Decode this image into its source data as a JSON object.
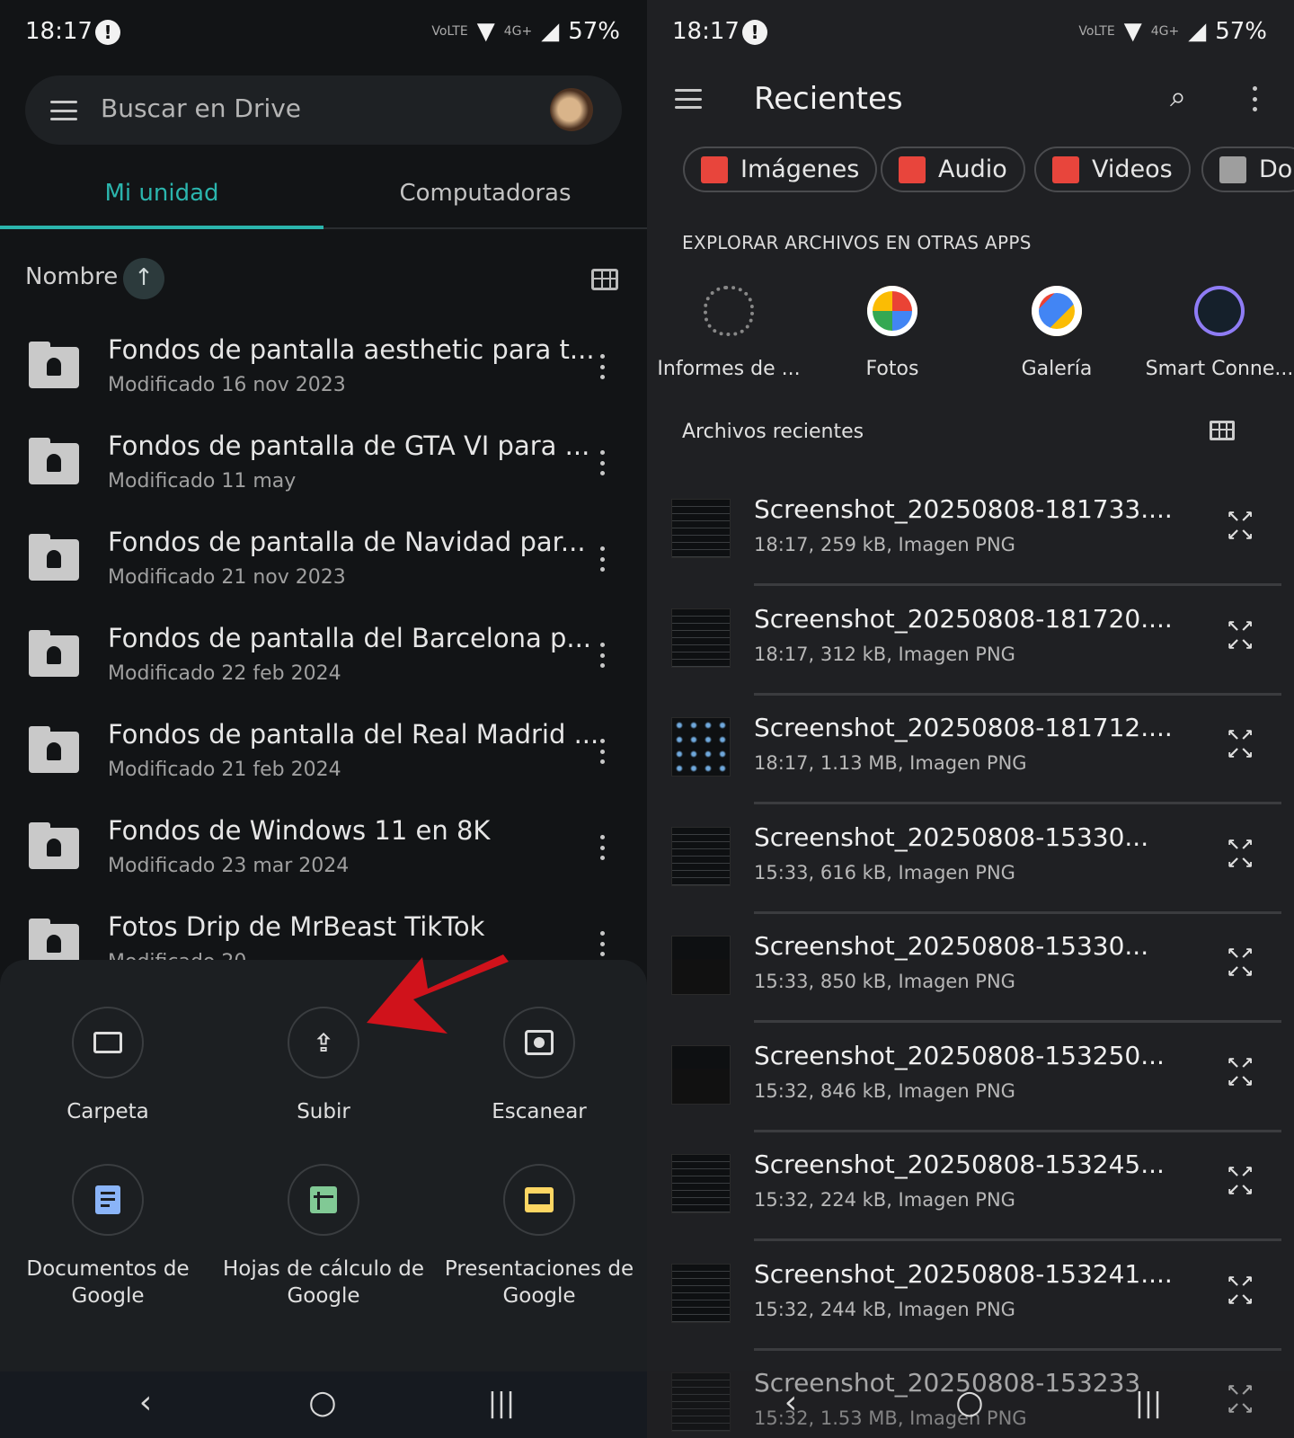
{
  "status_bar": {
    "time": "18:17",
    "network": "4G+",
    "battery": "57%",
    "volte": "VoLTE"
  },
  "drive": {
    "search_placeholder": "Buscar en Drive",
    "tabs": [
      {
        "label": "Mi unidad",
        "active": true
      },
      {
        "label": "Computadoras",
        "active": false
      }
    ],
    "sort_label": "Nombre",
    "accent_color": "#2bb5ad",
    "folders": [
      {
        "name": "Fondos de pantalla aesthetic para t...",
        "modified": "Modificado 16 nov 2023"
      },
      {
        "name": "Fondos de pantalla de GTA VI para ...",
        "modified": "Modificado 11 may"
      },
      {
        "name": "Fondos de pantalla de Navidad par...",
        "modified": "Modificado 21 nov 2023"
      },
      {
        "name": "Fondos de pantalla del Barcelona p...",
        "modified": "Modificado 22 feb 2024"
      },
      {
        "name": "Fondos de pantalla del Real Madrid ...",
        "modified": "Modificado 21 feb 2024"
      },
      {
        "name": "Fondos de Windows 11 en 8K",
        "modified": "Modificado 23 mar 2024"
      },
      {
        "name": "Fotos Drip de MrBeast TikTok",
        "modified": "Modificado 20..."
      }
    ],
    "create_sheet": [
      {
        "label": "Carpeta",
        "icon": "folder-icon"
      },
      {
        "label": "Subir",
        "icon": "upload-icon"
      },
      {
        "label": "Escanear",
        "icon": "camera-icon"
      },
      {
        "label": "Documentos de Google",
        "icon": "docs-icon",
        "color": "#8ab4f8"
      },
      {
        "label": "Hojas de cálculo de Google",
        "icon": "sheets-icon",
        "color": "#81c995"
      },
      {
        "label": "Presentaciones de Google",
        "icon": "slides-icon",
        "color": "#fdd663"
      }
    ]
  },
  "files": {
    "title": "Recientes",
    "chips": [
      {
        "label": "Imágenes",
        "color": "#e8453c"
      },
      {
        "label": "Audio",
        "color": "#e8453c"
      },
      {
        "label": "Videos",
        "color": "#e8453c"
      },
      {
        "label": "Do",
        "color": "#9e9e9e"
      }
    ],
    "explore_heading": "EXPLORAR ARCHIVOS EN OTRAS APPS",
    "apps": [
      {
        "label": "Informes de ..."
      },
      {
        "label": "Fotos"
      },
      {
        "label": "Galería"
      },
      {
        "label": "Smart Conne..."
      }
    ],
    "recent_heading": "Archivos recientes",
    "recent_files": [
      {
        "name": "Screenshot_20250808-181733....",
        "meta": "18:17, 259 kB, Imagen PNG"
      },
      {
        "name": "Screenshot_20250808-181720....",
        "meta": "18:17, 312 kB, Imagen PNG"
      },
      {
        "name": "Screenshot_20250808-181712....",
        "meta": "18:17, 1.13 MB, Imagen PNG"
      },
      {
        "name": "Screenshot_20250808-15330...",
        "meta": "15:33, 616 kB, Imagen PNG"
      },
      {
        "name": "Screenshot_20250808-15330...",
        "meta": "15:33, 850 kB, Imagen PNG"
      },
      {
        "name": "Screenshot_20250808-153250...",
        "meta": "15:32, 846 kB, Imagen PNG"
      },
      {
        "name": "Screenshot_20250808-153245...",
        "meta": "15:32, 224 kB, Imagen PNG"
      },
      {
        "name": "Screenshot_20250808-153241....",
        "meta": "15:32, 244 kB, Imagen PNG"
      },
      {
        "name": "Screenshot_20250808-153233",
        "meta": "15:32, 1.53 MB, Imagen PNG"
      }
    ]
  },
  "annotation_arrow_color": "#d0121b"
}
